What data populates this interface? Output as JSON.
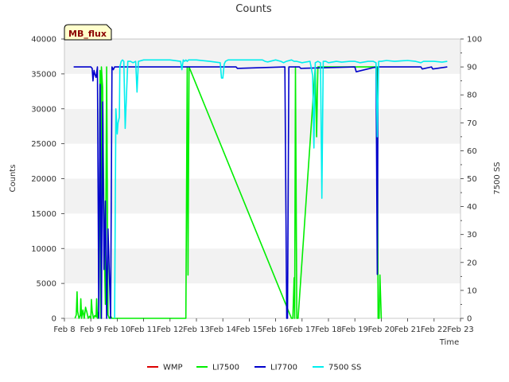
{
  "chart_data": {
    "type": "line",
    "title": "Counts",
    "xlabel": "Time",
    "ylabel": "Counts",
    "y2label": "7500 SS",
    "ylim": [
      0,
      40000
    ],
    "y2lim": [
      0,
      100
    ],
    "xlim": [
      8,
      23
    ],
    "x_ticks": [
      {
        "value": 8,
        "label": "Feb 8"
      },
      {
        "value": 9,
        "label": "Feb 9"
      },
      {
        "value": 10,
        "label": "Feb 10"
      },
      {
        "value": 11,
        "label": "Feb 11"
      },
      {
        "value": 12,
        "label": "Feb 12"
      },
      {
        "value": 13,
        "label": "Feb 13"
      },
      {
        "value": 14,
        "label": "Feb 14"
      },
      {
        "value": 15,
        "label": "Feb 15"
      },
      {
        "value": 16,
        "label": "Feb 16"
      },
      {
        "value": 17,
        "label": "Feb 17"
      },
      {
        "value": 18,
        "label": "Feb 18"
      },
      {
        "value": 19,
        "label": "Feb 19"
      },
      {
        "value": 20,
        "label": "Feb 20"
      },
      {
        "value": 21,
        "label": "Feb 21"
      },
      {
        "value": 22,
        "label": "Feb 22"
      },
      {
        "value": 23,
        "label": "Feb 23"
      }
    ],
    "y_ticks": [
      0,
      5000,
      10000,
      15000,
      20000,
      25000,
      30000,
      35000,
      40000
    ],
    "y2_ticks": [
      0,
      10,
      20,
      30,
      40,
      50,
      60,
      70,
      80,
      90,
      100
    ],
    "grid": "horizontal bands",
    "legend_position": "bottom",
    "annotation": "MB_flux",
    "series": [
      {
        "name": "WMP",
        "color": "#dd0000",
        "axis": "left",
        "x": [],
        "y": []
      },
      {
        "name": "LI7500",
        "color": "#00ee00",
        "axis": "left",
        "x": [
          8.4,
          8.45,
          8.48,
          8.5,
          8.55,
          8.6,
          8.62,
          8.65,
          8.7,
          8.75,
          8.8,
          8.82,
          8.85,
          8.9,
          8.95,
          9.0,
          9.02,
          9.05,
          9.1,
          9.15,
          9.2,
          9.22,
          9.25,
          9.3,
          9.32,
          9.35,
          9.38,
          9.4,
          9.45,
          9.5,
          9.55,
          9.6,
          9.65,
          9.7,
          9.75,
          9.8,
          9.85,
          9.88,
          9.9,
          12.6,
          12.65,
          12.68,
          12.72,
          16.6,
          16.65,
          16.7,
          16.72,
          16.75,
          16.8,
          16.85,
          17.5,
          17.55,
          17.6,
          19.85,
          19.88,
          19.92,
          19.95,
          20.0
        ],
        "y": [
          0,
          500,
          3800,
          1000,
          0,
          400,
          2800,
          0,
          1200,
          0,
          1600,
          1300,
          900,
          0,
          300,
          0,
          2700,
          1000,
          0,
          400,
          200,
          2800,
          0,
          1000,
          10500,
          35500,
          0,
          36000,
          33000,
          12000,
          2000,
          36000,
          500,
          0,
          300,
          0,
          0,
          0,
          0,
          0,
          36000,
          6200,
          36000,
          0,
          0,
          5800,
          0,
          36000,
          0,
          0,
          36000,
          26000,
          36000,
          36000,
          0,
          0,
          6200,
          0
        ]
      },
      {
        "name": "LI7700",
        "color": "#0000cc",
        "axis": "left",
        "x": [
          8.35,
          9.0,
          9.05,
          9.08,
          9.12,
          9.15,
          9.2,
          9.25,
          9.3,
          9.35,
          9.4,
          9.45,
          9.5,
          9.55,
          9.6,
          9.65,
          9.7,
          9.75,
          9.8,
          9.85,
          9.9,
          9.95,
          10.0,
          14.5,
          14.55,
          16.35,
          16.42,
          16.45,
          16.5,
          16.55,
          16.9,
          16.95,
          19.0,
          19.05,
          19.8,
          19.85,
          19.88,
          19.92,
          19.95,
          20.0,
          21.5,
          21.55,
          21.9,
          21.95,
          22.5
        ],
        "y": [
          36000,
          36000,
          35800,
          34000,
          35500,
          35000,
          34500,
          36000,
          0,
          33500,
          0,
          31000,
          7000,
          16800,
          0,
          12800,
          6800,
          0,
          36000,
          35600,
          36000,
          36000,
          36000,
          36000,
          35800,
          36000,
          0,
          0,
          36000,
          36000,
          36000,
          35800,
          36000,
          35300,
          36000,
          6300,
          36000,
          36000,
          36000,
          36000,
          36000,
          35700,
          36000,
          35700,
          36000
        ]
      },
      {
        "name": "7500 SS",
        "color": "#00eeee",
        "axis": "right",
        "x": [
          9.9,
          9.95,
          10.0,
          10.03,
          10.08,
          10.1,
          10.15,
          10.2,
          10.25,
          10.3,
          10.4,
          10.5,
          10.6,
          10.7,
          10.75,
          10.8,
          11.0,
          11.5,
          12.0,
          12.4,
          12.45,
          12.5,
          12.55,
          12.6,
          12.65,
          12.7,
          12.8,
          13.0,
          13.5,
          13.9,
          13.95,
          14.0,
          14.05,
          14.1,
          14.2,
          14.5,
          15.0,
          15.5,
          15.6,
          15.7,
          16.0,
          16.2,
          16.3,
          16.4,
          16.6,
          16.7,
          16.8,
          17.0,
          17.3,
          17.4,
          17.45,
          17.5,
          17.6,
          17.7,
          17.75,
          17.8,
          17.9,
          18.0,
          18.3,
          18.5,
          18.8,
          19.0,
          19.2,
          19.5,
          19.7,
          19.8,
          19.85,
          19.9,
          19.95,
          20.0,
          20.2,
          20.5,
          21.0,
          21.3,
          21.5,
          21.6,
          21.8,
          22.0,
          22.3,
          22.5
        ],
        "y": [
          0,
          75,
          66,
          70,
          72,
          90,
          92,
          92.5,
          92,
          68,
          92,
          92,
          91.5,
          92,
          81,
          92,
          92.5,
          92.5,
          92.5,
          92,
          89,
          92.5,
          92,
          92.5,
          92,
          92.5,
          92.5,
          92.5,
          92,
          91.5,
          86,
          86,
          91,
          92,
          92.5,
          92.5,
          92.5,
          92.5,
          92,
          91.8,
          92.5,
          92,
          91.5,
          92,
          92.5,
          92,
          92,
          91.5,
          92,
          87,
          61,
          91.5,
          92,
          91.5,
          43,
          92,
          92,
          91.5,
          92,
          91.7,
          92,
          92,
          91.5,
          92,
          92,
          91.5,
          65,
          92,
          92,
          92,
          92.3,
          92,
          92.3,
          92,
          91.5,
          92,
          92,
          92,
          91.7,
          92
        ]
      }
    ]
  }
}
